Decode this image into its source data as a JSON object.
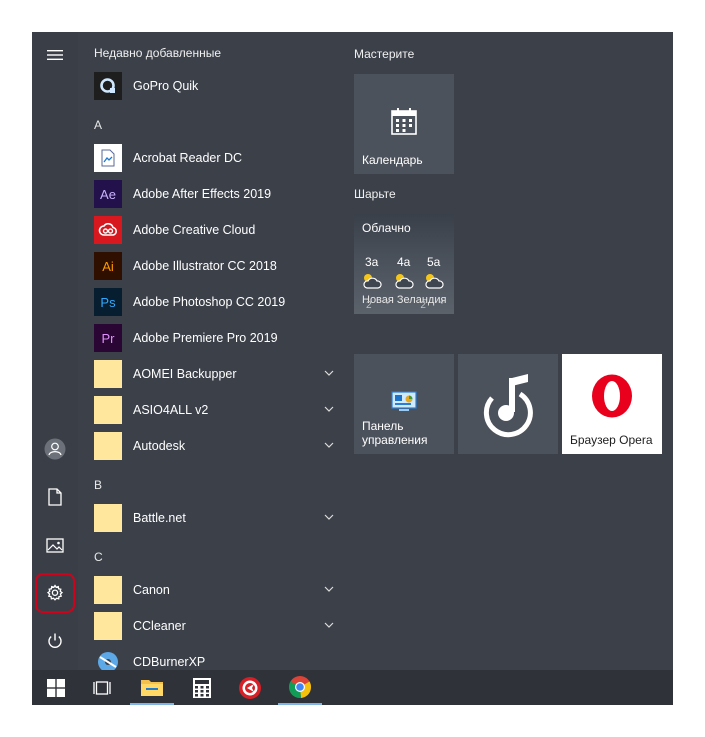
{
  "applist": {
    "recent_header": "Недавно добавленные",
    "recent_app": "GoPro Quik",
    "letters": [
      "A",
      "B",
      "C"
    ],
    "apps_a": [
      {
        "name": "Acrobat Reader DC",
        "icon": "acrobat-icon"
      },
      {
        "name": "Adobe After Effects 2019",
        "icon": "after-effects-icon"
      },
      {
        "name": "Adobe Creative Cloud",
        "icon": "creative-cloud-icon"
      },
      {
        "name": "Adobe Illustrator CC 2018",
        "icon": "illustrator-icon"
      },
      {
        "name": "Adobe Photoshop CC 2019",
        "icon": "photoshop-icon"
      },
      {
        "name": "Adobe Premiere Pro 2019",
        "icon": "premiere-icon"
      },
      {
        "name": "AOMEI Backupper",
        "icon": "folder-icon"
      },
      {
        "name": "ASIO4ALL v2",
        "icon": "folder-icon"
      },
      {
        "name": "Autodesk",
        "icon": "folder-icon"
      }
    ],
    "apps_b": [
      {
        "name": "Battle.net",
        "icon": "folder-icon"
      }
    ],
    "apps_c": [
      {
        "name": "Canon",
        "icon": "folder-icon"
      },
      {
        "name": "CCleaner",
        "icon": "folder-icon"
      },
      {
        "name": "CDBurnerXP",
        "icon": "cdburner-icon"
      }
    ],
    "icon_text": {
      "ae": "Ae",
      "ai": "Ai",
      "ps": "Ps",
      "pr": "Pr"
    }
  },
  "tiles": {
    "group1_name": "Мастерите",
    "group2_name": "Шарьте",
    "calendar_label": "Календарь",
    "weather": {
      "condition": "Облачно",
      "days": [
        "3а",
        "4а",
        "5а"
      ],
      "location_overlay": "Новая Зеландия",
      "temps_overlay": "2° 2° 2°"
    },
    "control_panel_label_line1": "Панель",
    "control_panel_label_line2": "управления",
    "opera_label": "Браузер Opera"
  },
  "colors": {
    "accent_red": "#d0021b",
    "tile_bg": "#4c525b",
    "opera_red": "#e8001d",
    "folder_yellow": "#ffe79d"
  }
}
